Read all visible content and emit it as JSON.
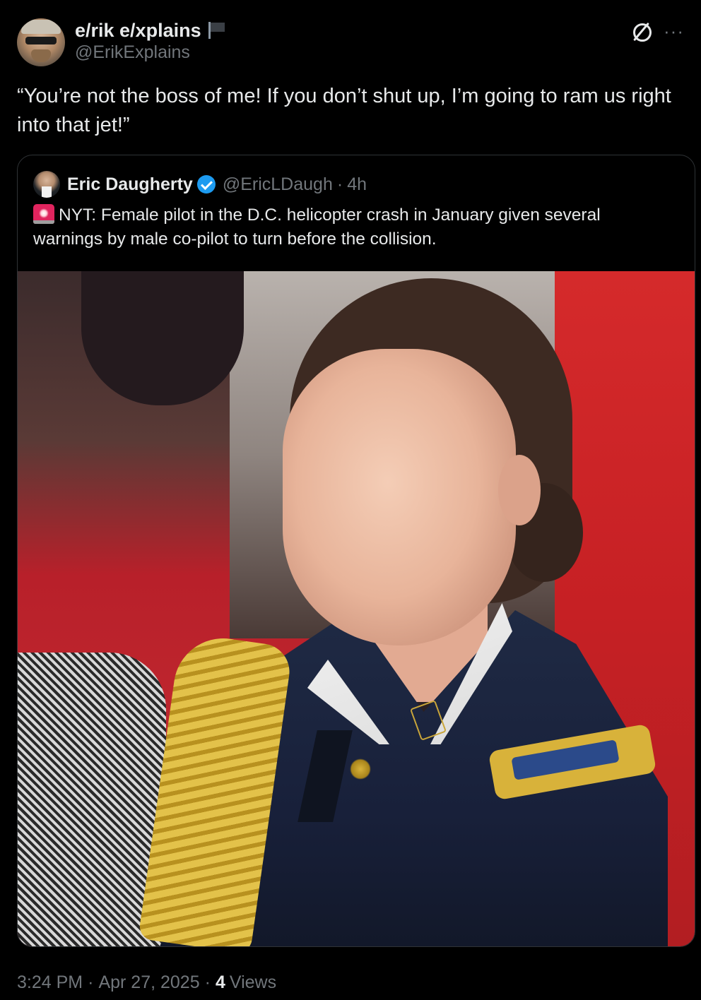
{
  "tweet": {
    "author": {
      "display_name": "e/rik e/xplains",
      "handle": "@ErikExplains",
      "badge_icon": "flag-icon"
    },
    "text": "“You’re not the boss of me! If you don’t shut up, I’m going to ram us right into that jet!”",
    "actions": {
      "grok_icon": "grok-icon",
      "more_icon": "more-icon",
      "more_label": "···"
    },
    "footer": {
      "time": "3:24 PM",
      "separator": "·",
      "date": "Apr 27, 2025",
      "views_count": "4",
      "views_label": "Views"
    }
  },
  "quote": {
    "author": {
      "display_name": "Eric Daugherty",
      "handle": "@EricLDaugh",
      "separator": "·",
      "time_ago": "4h",
      "verified_icon": "verified-icon"
    },
    "text_icon": "siren-icon",
    "text": "NYT: Female pilot in the D.C. helicopter crash in January given several warnings by male co-pilot to turn before the collision.",
    "media_icon": "photo"
  },
  "colors": {
    "background": "#000000",
    "text_primary": "#e7e9ea",
    "text_secondary": "#71767b",
    "border": "#2f3336",
    "verified": "#1d9bf0",
    "siren": "#e0245e"
  }
}
